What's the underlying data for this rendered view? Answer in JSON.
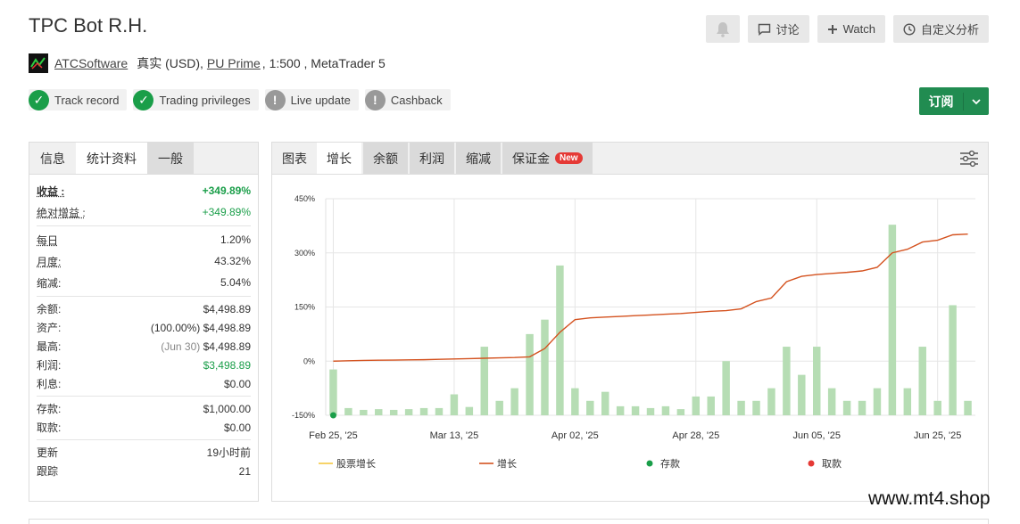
{
  "header": {
    "title": "TPC Bot R.H.",
    "author": "ATCSoftware",
    "account_type": "真实 (USD),",
    "broker": "PU Prime",
    "leverage_platform": ", 1:500 , MetaTrader 5"
  },
  "topbar": {
    "discuss_label": "讨论",
    "watch_label": "Watch",
    "custom_label": "自定义分析"
  },
  "badges": [
    {
      "label": "Track record",
      "status": "ok"
    },
    {
      "label": "Trading privileges",
      "status": "ok"
    },
    {
      "label": "Live update",
      "status": "warn"
    },
    {
      "label": "Cashback",
      "status": "warn"
    }
  ],
  "subscribe": {
    "label": "订阅"
  },
  "left_tabs": [
    "信息",
    "统计资料",
    "一般"
  ],
  "stats": {
    "gain_k": "收益 :",
    "gain_v": "+349.89%",
    "abs_k": "绝对增益 :",
    "abs_v": "+349.89%",
    "daily_k": "每日",
    "daily_v": "1.20%",
    "monthly_k": "月度:",
    "monthly_v": "43.32%",
    "dd_k": "缩减:",
    "dd_v": "5.04%",
    "balance_k": "余额:",
    "balance_v": "$4,498.89",
    "equity_k": "资产:",
    "equity_pct": "(100.00%)",
    "equity_v": "$4,498.89",
    "highest_k": "最高:",
    "highest_date": "(Jun 30)",
    "highest_v": "$4,498.89",
    "profit_k": "利润:",
    "profit_v": "$3,498.89",
    "interest_k": "利息:",
    "interest_v": "$0.00",
    "deposits_k": "存款:",
    "deposits_v": "$1,000.00",
    "withdrawals_k": "取款:",
    "withdrawals_v": "$0.00",
    "updated_k": "更新",
    "updated_v": "19小时前",
    "tracking_k": "跟踪",
    "tracking_v": "21"
  },
  "chart_tabs": [
    "图表",
    "增长",
    "余额",
    "利润",
    "缩减",
    "保证金"
  ],
  "new_tag": "New",
  "chart_data": {
    "type": "bar+line",
    "yticks": [
      "450%",
      "300%",
      "150%",
      "0%",
      "-150%"
    ],
    "ylim": [
      -150,
      450
    ],
    "xticks": [
      {
        "label": "Feb 25, '25",
        "i": 0
      },
      {
        "label": "Mar 13, '25",
        "i": 8
      },
      {
        "label": "Apr 02, '25",
        "i": 16
      },
      {
        "label": "Apr 28, '25",
        "i": 24
      },
      {
        "label": "Jun 05, '25",
        "i": 32
      },
      {
        "label": "Jun 25, '25",
        "i": 40
      }
    ],
    "bars": [
      -23,
      -130,
      -135,
      -133,
      -135,
      -133,
      -130,
      -130,
      -92,
      -127,
      40,
      -110,
      -75,
      75,
      115,
      265,
      -75,
      -110,
      -85,
      -125,
      -125,
      -130,
      -125,
      -133,
      -98,
      -98,
      0,
      -110,
      -110,
      -75,
      40,
      -38,
      40,
      -75,
      -110,
      -110,
      -75,
      378,
      -75,
      40,
      -110,
      155,
      -110
    ],
    "growth": [
      0,
      1,
      2,
      2.5,
      3,
      3.5,
      4,
      5,
      6,
      7,
      8,
      9,
      10,
      12,
      35,
      80,
      115,
      120,
      122,
      124,
      126,
      128,
      130,
      132,
      135,
      138,
      140,
      145,
      165,
      175,
      220,
      235,
      240,
      243,
      246,
      250,
      260,
      300,
      310,
      330,
      335,
      350,
      352
    ],
    "legend": [
      {
        "label": "股票增长",
        "color": "#f5c842",
        "kind": "line"
      },
      {
        "label": "增长",
        "color": "#d4521f",
        "kind": "line"
      },
      {
        "label": "存款",
        "color": "#1a9e49",
        "kind": "dot"
      },
      {
        "label": "取款",
        "color": "#e53935",
        "kind": "dot"
      }
    ],
    "bar_color": "#b6ddb4",
    "line_color": "#d4521f"
  },
  "watermark": "www.mt4.shop"
}
